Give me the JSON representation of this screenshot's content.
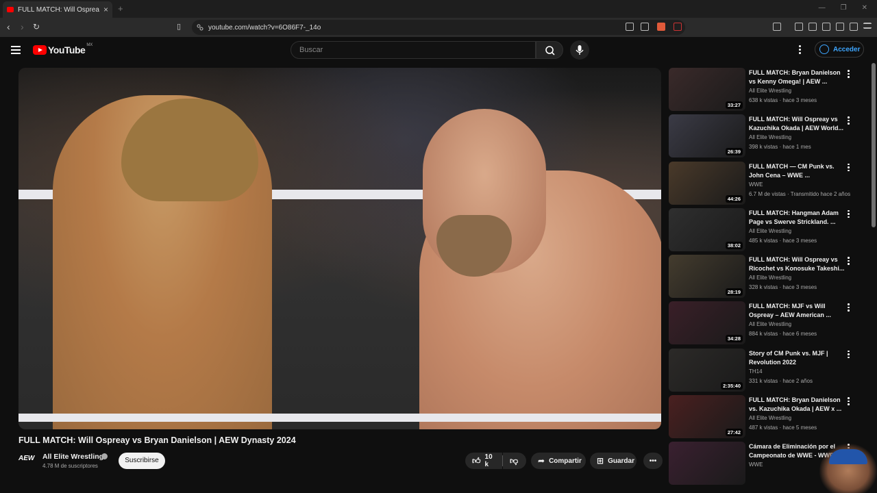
{
  "browser": {
    "tab_title": "FULL MATCH: Will Ospreay vs Br",
    "url": "youtube.com/watch?v=6O86F7-_14o"
  },
  "header": {
    "logo_text": "YouTube",
    "country_code": "MX",
    "search_placeholder": "Buscar",
    "signin_label": "Acceder"
  },
  "video": {
    "title": "FULL MATCH: Will Ospreay vs Bryan Danielson | AEW Dynasty 2024",
    "channel_logo": "AEW",
    "channel": "All Elite Wrestling",
    "subscribers": "4.78 M de suscriptores",
    "subscribe_label": "Suscribirse",
    "likes": "10 k",
    "share_label": "Compartir",
    "save_label": "Guardar"
  },
  "recommendations": [
    {
      "title": "FULL MATCH: Bryan Danielson vs Kenny Omega! | AEW ...",
      "channel": "All Elite Wrestling",
      "meta": "638 k vistas · hace 3 meses",
      "duration": "33:27",
      "color": "#3a2a2a"
    },
    {
      "title": "FULL MATCH: Will Ospreay vs Kazuchika Okada | AEW World...",
      "channel": "All Elite Wrestling",
      "meta": "398 k vistas · hace 1 mes",
      "duration": "26:39",
      "color": "#3b3b46"
    },
    {
      "title": "FULL MATCH — CM Punk vs. John Cena – WWE ...",
      "channel": "WWE",
      "meta": "6.7 M de vistas · Transmitido hace 2 años",
      "duration": "44:26",
      "color": "#4a3a2a"
    },
    {
      "title": "FULL MATCH: Hangman Adam Page vs Swerve Strickland. ...",
      "channel": "All Elite Wrestling",
      "meta": "485 k vistas · hace 3 meses",
      "duration": "38:02",
      "color": "#2f2f2f"
    },
    {
      "title": "FULL MATCH: Will Ospreay vs Ricochet vs Konosuke Takeshi...",
      "channel": "All Elite Wrestling",
      "meta": "328 k vistas · hace 3 meses",
      "duration": "28:19",
      "color": "#443c2e"
    },
    {
      "title": "FULL MATCH: MJF vs Will Ospreay – AEW American ...",
      "channel": "All Elite Wrestling",
      "meta": "884 k vistas · hace 6 meses",
      "duration": "34:28",
      "color": "#3a1f28"
    },
    {
      "title": "Story of CM Punk vs. MJF | Revolution 2022",
      "channel": "TH14",
      "meta": "331 k vistas · hace 2 años",
      "duration": "2:35:40",
      "color": "#2c2a28"
    },
    {
      "title": "FULL MATCH: Bryan Danielson vs. Kazuchika Okada | AEW x ...",
      "channel": "All Elite Wrestling",
      "meta": "487 k vistas · hace 5 meses",
      "duration": "27:42",
      "color": "#4a2020"
    },
    {
      "title": "Cámara de Eliminación por el Campeonato de WWE - WWE ...",
      "channel": "WWE",
      "meta": "",
      "duration": "",
      "color": "#3a2030"
    }
  ]
}
